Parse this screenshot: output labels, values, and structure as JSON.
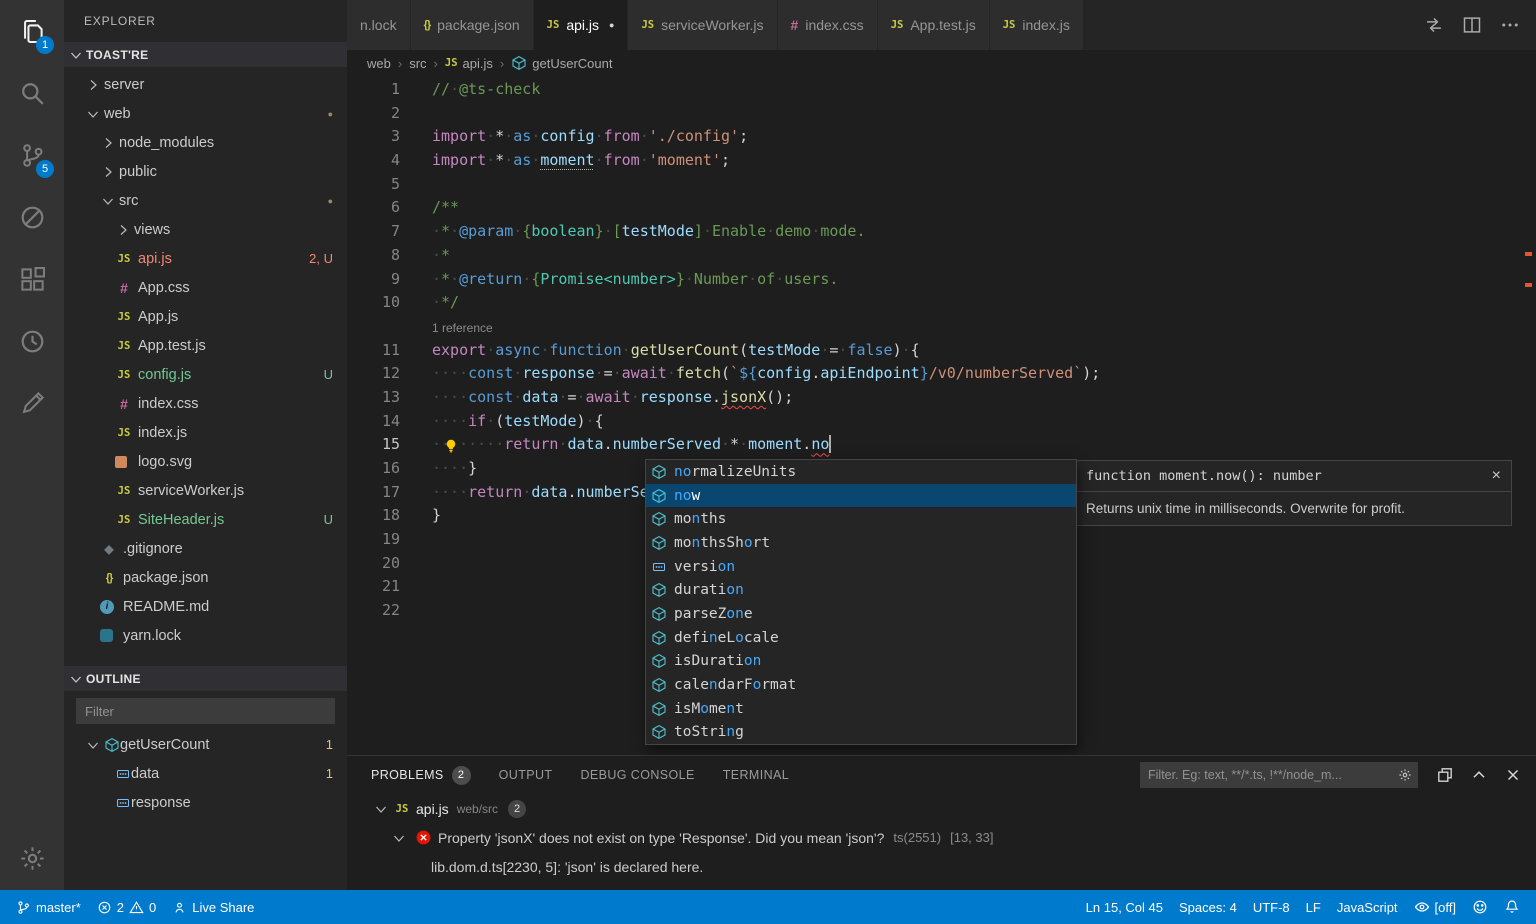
{
  "activity_bar": {
    "explorer_badge": "1",
    "scm_badge": "5"
  },
  "sidebar": {
    "title": "EXPLORER",
    "workspace": "TOAST'RE",
    "files": [
      {
        "label": "server",
        "type": "folder",
        "chev": "right",
        "indent": 1
      },
      {
        "label": "web",
        "type": "folder",
        "chev": "down",
        "indent": 1,
        "dot": true
      },
      {
        "label": "node_modules",
        "type": "folder",
        "chev": "right",
        "indent": 2
      },
      {
        "label": "public",
        "type": "folder",
        "chev": "right",
        "indent": 2
      },
      {
        "label": "src",
        "type": "folder",
        "chev": "down",
        "indent": 2,
        "dot": true
      },
      {
        "label": "views",
        "type": "folder",
        "chev": "right",
        "indent": 3
      },
      {
        "label": "api.js",
        "icon": "js",
        "indent": 3,
        "color": "error",
        "badge": "2, U"
      },
      {
        "label": "App.css",
        "icon": "css",
        "indent": 3
      },
      {
        "label": "App.js",
        "icon": "js",
        "indent": 3
      },
      {
        "label": "App.test.js",
        "icon": "js",
        "indent": 3
      },
      {
        "label": "config.js",
        "icon": "js",
        "indent": 3,
        "color": "untracked",
        "badge": "U"
      },
      {
        "label": "index.css",
        "icon": "css",
        "indent": 3
      },
      {
        "label": "index.js",
        "icon": "js",
        "indent": 3
      },
      {
        "label": "logo.svg",
        "icon": "svg",
        "indent": 3
      },
      {
        "label": "serviceWorker.js",
        "icon": "js",
        "indent": 3
      },
      {
        "label": "SiteHeader.js",
        "icon": "js",
        "indent": 3,
        "color": "untracked",
        "badge": "U"
      },
      {
        "label": ".gitignore",
        "icon": "git",
        "indent": 2
      },
      {
        "label": "package.json",
        "icon": "json",
        "indent": 2
      },
      {
        "label": "README.md",
        "icon": "info",
        "indent": 2
      },
      {
        "label": "yarn.lock",
        "icon": "lock",
        "indent": 2
      }
    ],
    "outline": {
      "title": "OUTLINE",
      "filter_placeholder": "Filter",
      "items": [
        {
          "label": "getUserCount",
          "icon": "method",
          "chev": "down",
          "indent": 1,
          "badge": "1"
        },
        {
          "label": "data",
          "icon": "field",
          "indent": 3,
          "badge": "1"
        },
        {
          "label": "response",
          "icon": "field",
          "indent": 3
        }
      ]
    }
  },
  "tabs": [
    {
      "label": "n.lock"
    },
    {
      "label": "package.json",
      "icon": "json"
    },
    {
      "label": "api.js",
      "icon": "js",
      "active": true,
      "dirty": true
    },
    {
      "label": "serviceWorker.js",
      "icon": "js"
    },
    {
      "label": "index.css",
      "icon": "css"
    },
    {
      "label": "App.test.js",
      "icon": "js"
    },
    {
      "label": "index.js",
      "icon": "js"
    }
  ],
  "breadcrumbs": [
    {
      "label": "web"
    },
    {
      "label": "src"
    },
    {
      "label": "api.js",
      "icon": "js"
    },
    {
      "label": "getUserCount",
      "icon": "method"
    }
  ],
  "editor": {
    "codelens": "1 reference",
    "lines": [
      {
        "n": 1,
        "segs": [
          [
            "cmt",
            "//"
          ],
          [
            "ws",
            "·"
          ],
          [
            "cmt",
            "@ts-check"
          ]
        ]
      },
      {
        "n": 2,
        "segs": []
      },
      {
        "n": 3,
        "segs": [
          [
            "kw",
            "import"
          ],
          [
            "ws",
            "·"
          ],
          [
            "pln",
            "*"
          ],
          [
            "ws",
            "·"
          ],
          [
            "kb",
            "as"
          ],
          [
            "ws",
            "·"
          ],
          [
            "vr",
            "config"
          ],
          [
            "ws",
            "·"
          ],
          [
            "kw",
            "from"
          ],
          [
            "ws",
            "·"
          ],
          [
            "str",
            "'./config'"
          ],
          [
            "pln",
            ";"
          ]
        ]
      },
      {
        "n": 4,
        "segs": [
          [
            "kw",
            "import"
          ],
          [
            "ws",
            "·"
          ],
          [
            "pln",
            "*"
          ],
          [
            "ws",
            "·"
          ],
          [
            "kb",
            "as"
          ],
          [
            "ws",
            "·"
          ],
          [
            "vru",
            "moment"
          ],
          [
            "ws",
            "·"
          ],
          [
            "kw",
            "from"
          ],
          [
            "ws",
            "·"
          ],
          [
            "str",
            "'moment'"
          ],
          [
            "pln",
            ";"
          ]
        ]
      },
      {
        "n": 5,
        "segs": []
      },
      {
        "n": 6,
        "segs": [
          [
            "cmt",
            "/**"
          ]
        ]
      },
      {
        "n": 7,
        "segs": [
          [
            "ws",
            "·"
          ],
          [
            "cmt",
            "*"
          ],
          [
            "ws",
            "·"
          ],
          [
            "kb",
            "@param"
          ],
          [
            "ws",
            "·"
          ],
          [
            "cmt",
            "{"
          ],
          [
            "typ",
            "boolean"
          ],
          [
            "cmt",
            "}"
          ],
          [
            "ws",
            "·"
          ],
          [
            "cmt",
            "["
          ],
          [
            "vr",
            "testMode"
          ],
          [
            "cmt",
            "]"
          ],
          [
            "ws",
            "·"
          ],
          [
            "cmt",
            "Enable"
          ],
          [
            "ws",
            "·"
          ],
          [
            "cmt",
            "demo"
          ],
          [
            "ws",
            "·"
          ],
          [
            "cmt",
            "mode."
          ]
        ]
      },
      {
        "n": 8,
        "segs": [
          [
            "ws",
            "·"
          ],
          [
            "cmt",
            "*"
          ]
        ]
      },
      {
        "n": 9,
        "segs": [
          [
            "ws",
            "·"
          ],
          [
            "cmt",
            "*"
          ],
          [
            "ws",
            "·"
          ],
          [
            "kb",
            "@return"
          ],
          [
            "ws",
            "·"
          ],
          [
            "cmt",
            "{"
          ],
          [
            "typ",
            "Promise<number>"
          ],
          [
            "cmt",
            "}"
          ],
          [
            "ws",
            "·"
          ],
          [
            "cmt",
            "Number"
          ],
          [
            "ws",
            "·"
          ],
          [
            "cmt",
            "of"
          ],
          [
            "ws",
            "·"
          ],
          [
            "cmt",
            "users."
          ]
        ]
      },
      {
        "n": 10,
        "segs": [
          [
            "ws",
            "·"
          ],
          [
            "cmt",
            "*/"
          ]
        ]
      },
      {
        "lens": true
      },
      {
        "n": 11,
        "segs": [
          [
            "kw",
            "export"
          ],
          [
            "ws",
            "·"
          ],
          [
            "kb",
            "async"
          ],
          [
            "ws",
            "·"
          ],
          [
            "kb",
            "function"
          ],
          [
            "ws",
            "·"
          ],
          [
            "fn",
            "getUserCount"
          ],
          [
            "pln",
            "("
          ],
          [
            "vr",
            "testMode"
          ],
          [
            "ws",
            "·"
          ],
          [
            "pln",
            "="
          ],
          [
            "ws",
            "·"
          ],
          [
            "kb",
            "false"
          ],
          [
            "pln",
            ")"
          ],
          [
            "ws",
            "·"
          ],
          [
            "pln",
            "{"
          ]
        ]
      },
      {
        "n": 12,
        "segs": [
          [
            "ws",
            "····"
          ],
          [
            "kb",
            "const"
          ],
          [
            "ws",
            "·"
          ],
          [
            "vr",
            "response"
          ],
          [
            "ws",
            "·"
          ],
          [
            "pln",
            "="
          ],
          [
            "ws",
            "·"
          ],
          [
            "kw",
            "await"
          ],
          [
            "ws",
            "·"
          ],
          [
            "fn",
            "fetch"
          ],
          [
            "pln",
            "("
          ],
          [
            "str",
            "`"
          ],
          [
            "kb",
            "${"
          ],
          [
            "vr",
            "config"
          ],
          [
            "pln",
            "."
          ],
          [
            "vr",
            "apiEndpoint"
          ],
          [
            "kb",
            "}"
          ],
          [
            "str",
            "/v0/numberServed`"
          ],
          [
            "pln",
            ");"
          ]
        ]
      },
      {
        "n": 13,
        "segs": [
          [
            "ws",
            "····"
          ],
          [
            "kb",
            "const"
          ],
          [
            "ws",
            "·"
          ],
          [
            "vr",
            "data"
          ],
          [
            "ws",
            "·"
          ],
          [
            "pln",
            "="
          ],
          [
            "ws",
            "·"
          ],
          [
            "kw",
            "await"
          ],
          [
            "ws",
            "·"
          ],
          [
            "vr",
            "response"
          ],
          [
            "pln",
            "."
          ],
          [
            "fnsq",
            "jsonX"
          ],
          [
            "pln",
            "();"
          ]
        ]
      },
      {
        "n": 14,
        "segs": [
          [
            "ws",
            "····"
          ],
          [
            "kw",
            "if"
          ],
          [
            "ws",
            "·"
          ],
          [
            "pln",
            "("
          ],
          [
            "vr",
            "testMode"
          ],
          [
            "pln",
            ")"
          ],
          [
            "ws",
            "·"
          ],
          [
            "pln",
            "{"
          ]
        ]
      },
      {
        "n": 15,
        "cur": true,
        "bulb": true,
        "segs": [
          [
            "ws",
            "········"
          ],
          [
            "kw",
            "return"
          ],
          [
            "ws",
            "·"
          ],
          [
            "vr",
            "data"
          ],
          [
            "pln",
            "."
          ],
          [
            "vr",
            "numberServed"
          ],
          [
            "ws",
            "·"
          ],
          [
            "pln",
            "*"
          ],
          [
            "ws",
            "·"
          ],
          [
            "vr",
            "moment"
          ],
          [
            "pln",
            "."
          ],
          [
            "vrsq",
            "no"
          ],
          [
            "caret",
            ""
          ]
        ]
      },
      {
        "n": 16,
        "segs": [
          [
            "ws",
            "····"
          ],
          [
            "pln",
            "}"
          ]
        ]
      },
      {
        "n": 17,
        "segs": [
          [
            "ws",
            "····"
          ],
          [
            "kw",
            "return"
          ],
          [
            "ws",
            "·"
          ],
          [
            "vr",
            "data"
          ],
          [
            "pln",
            "."
          ],
          [
            "vr",
            "numberServed"
          ],
          [
            "pln",
            ";"
          ]
        ]
      },
      {
        "n": 18,
        "segs": [
          [
            "pln",
            "}"
          ]
        ]
      },
      {
        "n": 19,
        "segs": []
      },
      {
        "n": 20,
        "segs": []
      },
      {
        "n": 21,
        "segs": []
      },
      {
        "n": 22,
        "segs": []
      }
    ]
  },
  "suggest": {
    "items": [
      {
        "label": "normalizeUnits",
        "icon": "method",
        "match": [
          0,
          1
        ]
      },
      {
        "label": "now",
        "icon": "method",
        "match": [
          0,
          1
        ],
        "selected": true
      },
      {
        "label": "months",
        "icon": "method",
        "match": [
          2
        ]
      },
      {
        "label": "monthsShort",
        "icon": "method",
        "match": [
          2,
          8
        ]
      },
      {
        "label": "version",
        "icon": "field",
        "match": [
          5,
          6
        ]
      },
      {
        "label": "duration",
        "icon": "method",
        "match": [
          6,
          7
        ]
      },
      {
        "label": "parseZone",
        "icon": "method",
        "match": [
          6,
          7
        ]
      },
      {
        "label": "defineLocale",
        "icon": "method",
        "match": [
          4,
          7
        ]
      },
      {
        "label": "isDuration",
        "icon": "method",
        "match": [
          8,
          9
        ]
      },
      {
        "label": "calendarFormat",
        "icon": "method",
        "match": [
          4,
          9
        ]
      },
      {
        "label": "isMoment",
        "icon": "method",
        "match": [
          3,
          6
        ]
      },
      {
        "label": "toString",
        "icon": "method",
        "match": [
          6
        ]
      }
    ],
    "doc": {
      "signature": "function moment.now(): number",
      "body": "Returns unix time in milliseconds. Overwrite for profit."
    }
  },
  "panel": {
    "tabs": [
      {
        "label": "PROBLEMS",
        "badge": "2",
        "active": true
      },
      {
        "label": "OUTPUT"
      },
      {
        "label": "DEBUG CONSOLE"
      },
      {
        "label": "TERMINAL"
      }
    ],
    "filter_placeholder": "Filter. Eg: text, **/*.ts, !**/node_m...",
    "rows": [
      {
        "kind": "file",
        "file": "api.js",
        "path": "web/src",
        "badge": "2"
      },
      {
        "kind": "error",
        "text": "Property 'jsonX' does not exist on type 'Response'. Did you mean 'json'?",
        "source": "ts(2551)",
        "pos": "[13, 33]"
      },
      {
        "kind": "related",
        "text": "lib.dom.d.ts[2230, 5]: 'json' is declared here."
      }
    ]
  },
  "status_bar": {
    "branch": "master*",
    "errors": "2",
    "warnings": "0",
    "live_share": "Live Share",
    "line_col": "Ln 15, Col 45",
    "spaces": "Spaces: 4",
    "encoding": "UTF-8",
    "eol": "LF",
    "language": "JavaScript",
    "toggle_off": "[off]"
  }
}
